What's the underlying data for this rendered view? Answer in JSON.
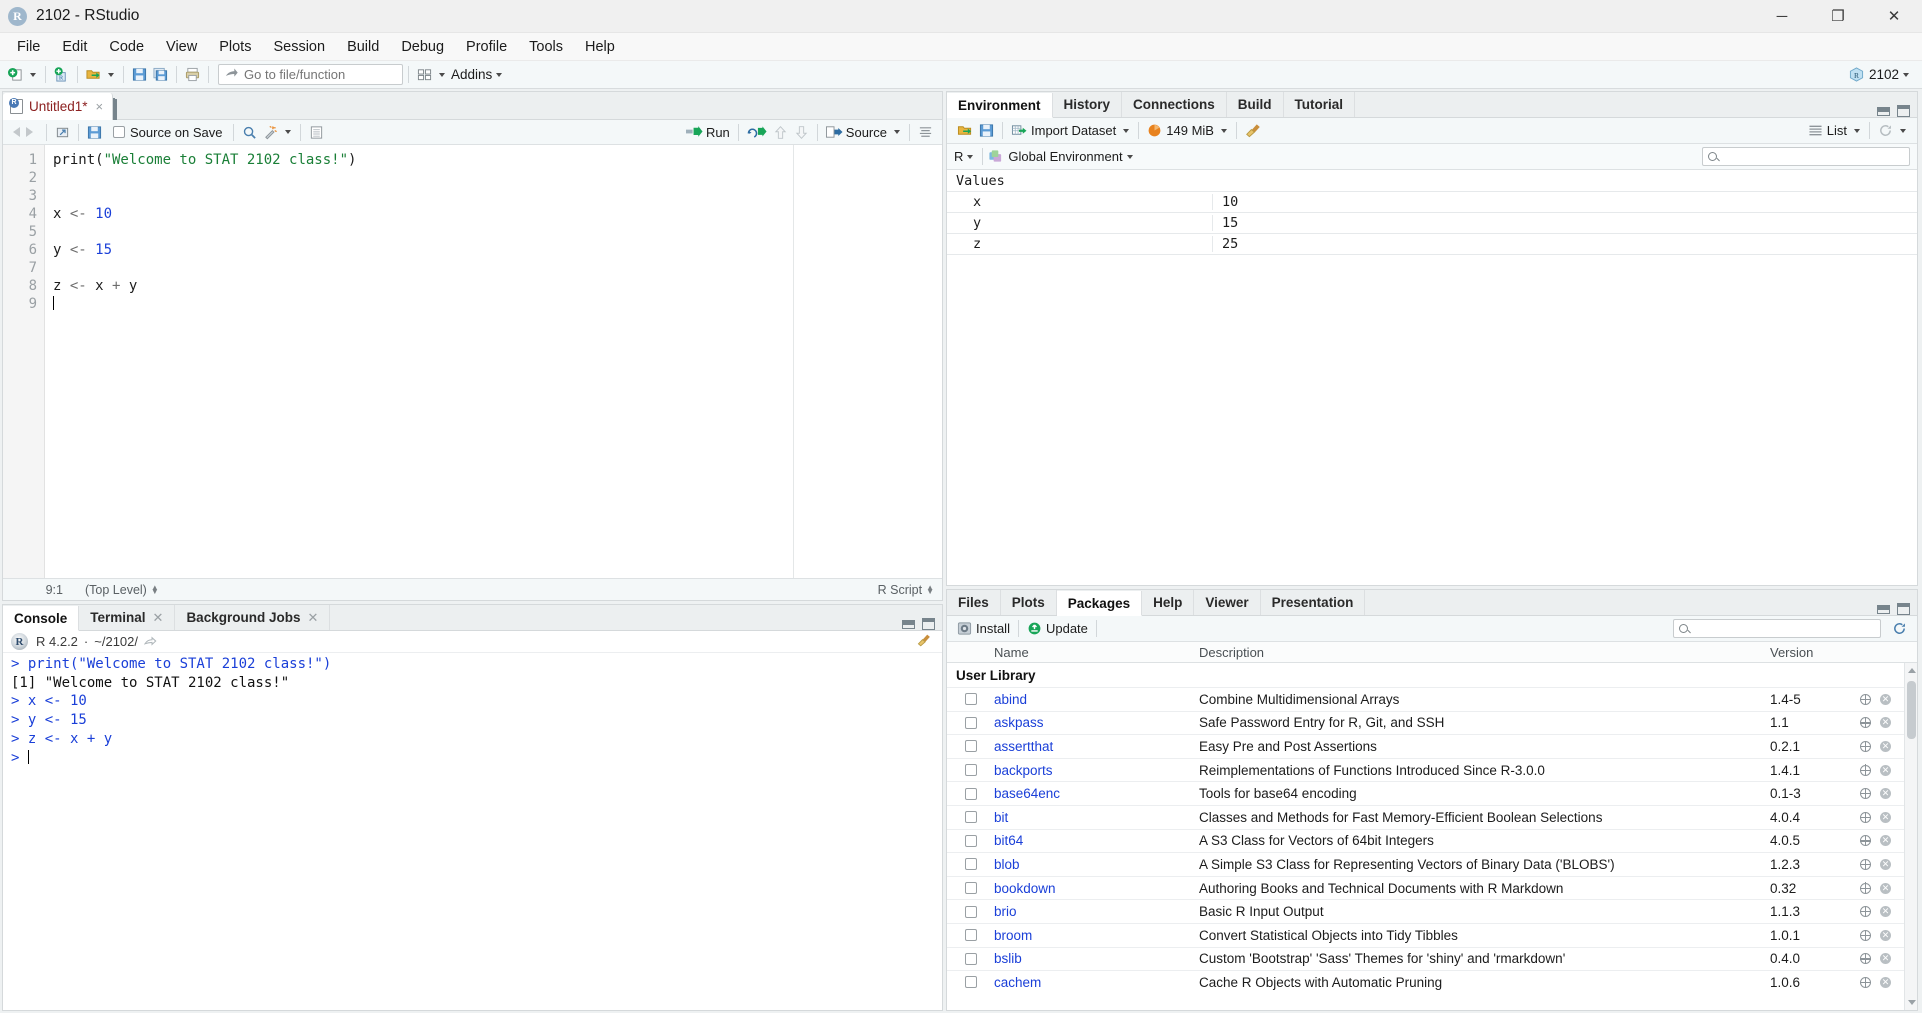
{
  "window": {
    "title": "2102 - RStudio",
    "app_icon": "R",
    "controls": {
      "minimize": "─",
      "maximize": "❐",
      "close": "✕"
    }
  },
  "menubar": {
    "items": [
      "File",
      "Edit",
      "Code",
      "View",
      "Plots",
      "Session",
      "Build",
      "Debug",
      "Profile",
      "Tools",
      "Help"
    ]
  },
  "toolbar": {
    "new_file_icon": "new-file-icon",
    "new_project_icon": "new-project-icon",
    "open_file_icon": "open-file-icon",
    "save_icon": "save-icon",
    "save_all_icon": "save-all-icon",
    "print_icon": "print-icon",
    "goto_placeholder": "Go to file/function",
    "goto_value": "",
    "panes_icon": "panes-layout-icon",
    "addins_label": "Addins",
    "project_name": "2102",
    "project_icon": "r-project-icon"
  },
  "source": {
    "tab": {
      "label": "Untitled1*",
      "close": "×",
      "icon": "r-script-file-icon"
    },
    "toolbar": {
      "back_icon": "back-arrow-icon",
      "forward_icon": "forward-arrow-icon",
      "popout_icon": "show-in-new-window-icon",
      "save_icon": "save-icon",
      "source_on_save_label": "Source on Save",
      "find_icon": "search-icon",
      "magic_icon": "code-tools-icon",
      "outline_icon": "document-outline-icon",
      "run_label": "Run",
      "rerun_icon": "rerun-icon",
      "prev_chunk_icon": "up-arrow-icon",
      "next_chunk_icon": "down-arrow-icon",
      "source_label": "Source",
      "compile_icon": "compile-report-icon"
    },
    "lines": [
      {
        "n": "1",
        "tokens": [
          {
            "t": "print(",
            "c": "fn"
          },
          {
            "t": "\"Welcome to STAT 2102 class!\"",
            "c": "str"
          },
          {
            "t": ")",
            "c": "fn"
          }
        ]
      },
      {
        "n": "2",
        "tokens": []
      },
      {
        "n": "3",
        "tokens": []
      },
      {
        "n": "4",
        "tokens": [
          {
            "t": "x ",
            "c": "fn"
          },
          {
            "t": "<- ",
            "c": "op"
          },
          {
            "t": "10",
            "c": "num"
          }
        ]
      },
      {
        "n": "5",
        "tokens": []
      },
      {
        "n": "6",
        "tokens": [
          {
            "t": "y ",
            "c": "fn"
          },
          {
            "t": "<- ",
            "c": "op"
          },
          {
            "t": "15",
            "c": "num"
          }
        ]
      },
      {
        "n": "7",
        "tokens": []
      },
      {
        "n": "8",
        "tokens": [
          {
            "t": "z ",
            "c": "fn"
          },
          {
            "t": "<- ",
            "c": "op"
          },
          {
            "t": "x ",
            "c": "fn"
          },
          {
            "t": "+ ",
            "c": "op"
          },
          {
            "t": "y",
            "c": "fn"
          }
        ]
      },
      {
        "n": "9",
        "tokens": []
      }
    ],
    "status": {
      "position": "9:1",
      "scope": "(Top Level)",
      "filetype": "R Script"
    }
  },
  "console_pane": {
    "tabs": [
      {
        "label": "Console",
        "active": true,
        "closable": false
      },
      {
        "label": "Terminal",
        "active": false,
        "closable": true
      },
      {
        "label": "Background Jobs",
        "active": false,
        "closable": true
      }
    ],
    "header": {
      "version": "R 4.2.2",
      "separator": "·",
      "path": "~/2102/",
      "popout_icon": "popout-icon"
    },
    "lines": [
      {
        "prompt": "> ",
        "text": "print(\"Welcome to STAT 2102 class!\")",
        "style": "blue"
      },
      {
        "prompt": "",
        "text": "[1] \"Welcome to STAT 2102 class!\"",
        "style": "black"
      },
      {
        "prompt": "> ",
        "text": "x <- 10",
        "style": "blue"
      },
      {
        "prompt": "> ",
        "text": "y <- 15",
        "style": "blue"
      },
      {
        "prompt": "> ",
        "text": "z <- x + y",
        "style": "blue"
      },
      {
        "prompt": "> ",
        "text": "",
        "style": "blue"
      }
    ]
  },
  "environment_pane": {
    "tabs": [
      {
        "label": "Environment",
        "active": true
      },
      {
        "label": "History",
        "active": false
      },
      {
        "label": "Connections",
        "active": false
      },
      {
        "label": "Build",
        "active": false
      },
      {
        "label": "Tutorial",
        "active": false
      }
    ],
    "toolbar": {
      "load_icon": "open-folder-icon",
      "save_icon": "save-icon",
      "import_label": "Import Dataset",
      "memory_label": "149 MiB",
      "memory_icon": "memory-usage-icon",
      "broom_icon": "clear-objects-icon",
      "list_label": "List",
      "list_icon": "list-view-icon",
      "refresh_icon": "refresh-icon"
    },
    "scope": {
      "language": "R",
      "environment": "Global Environment",
      "env_icon": "global-environment-icon"
    },
    "search_placeholder": "",
    "section_title": "Values",
    "values": [
      {
        "name": "x",
        "value": "10"
      },
      {
        "name": "y",
        "value": "15"
      },
      {
        "name": "z",
        "value": "25"
      }
    ]
  },
  "files_pane": {
    "tabs": [
      {
        "label": "Files",
        "active": false
      },
      {
        "label": "Plots",
        "active": false
      },
      {
        "label": "Packages",
        "active": true
      },
      {
        "label": "Help",
        "active": false
      },
      {
        "label": "Viewer",
        "active": false
      },
      {
        "label": "Presentation",
        "active": false
      }
    ],
    "toolbar": {
      "install_label": "Install",
      "install_icon": "install-package-icon",
      "update_label": "Update",
      "update_icon": "update-package-icon",
      "search_placeholder": "",
      "refresh_icon": "refresh-icon"
    },
    "columns": {
      "name": "Name",
      "description": "Description",
      "version": "Version"
    },
    "group_label": "User Library",
    "packages": [
      {
        "name": "abind",
        "description": "Combine Multidimensional Arrays",
        "version": "1.4-5"
      },
      {
        "name": "askpass",
        "description": "Safe Password Entry for R, Git, and SSH",
        "version": "1.1"
      },
      {
        "name": "assertthat",
        "description": "Easy Pre and Post Assertions",
        "version": "0.2.1"
      },
      {
        "name": "backports",
        "description": "Reimplementations of Functions Introduced Since R-3.0.0",
        "version": "1.4.1"
      },
      {
        "name": "base64enc",
        "description": "Tools for base64 encoding",
        "version": "0.1-3"
      },
      {
        "name": "bit",
        "description": "Classes and Methods for Fast Memory-Efficient Boolean Selections",
        "version": "4.0.4"
      },
      {
        "name": "bit64",
        "description": "A S3 Class for Vectors of 64bit Integers",
        "version": "4.0.5"
      },
      {
        "name": "blob",
        "description": "A Simple S3 Class for Representing Vectors of Binary Data ('BLOBS')",
        "version": "1.2.3"
      },
      {
        "name": "bookdown",
        "description": "Authoring Books and Technical Documents with R Markdown",
        "version": "0.32"
      },
      {
        "name": "brio",
        "description": "Basic R Input Output",
        "version": "1.1.3"
      },
      {
        "name": "broom",
        "description": "Convert Statistical Objects into Tidy Tibbles",
        "version": "1.0.1"
      },
      {
        "name": "bslib",
        "description": "Custom 'Bootstrap' 'Sass' Themes for 'shiny' and 'rmarkdown'",
        "version": "0.4.0"
      },
      {
        "name": "cachem",
        "description": "Cache R Objects with Automatic Pruning",
        "version": "1.0.6"
      }
    ]
  },
  "colors": {
    "accent_blue": "#1a3fd8",
    "string_green": "#1a7f37",
    "tab_text": "#8c2020",
    "pane_bg": "#eef1f2",
    "toolbar_bg": "#f4f8f9"
  }
}
